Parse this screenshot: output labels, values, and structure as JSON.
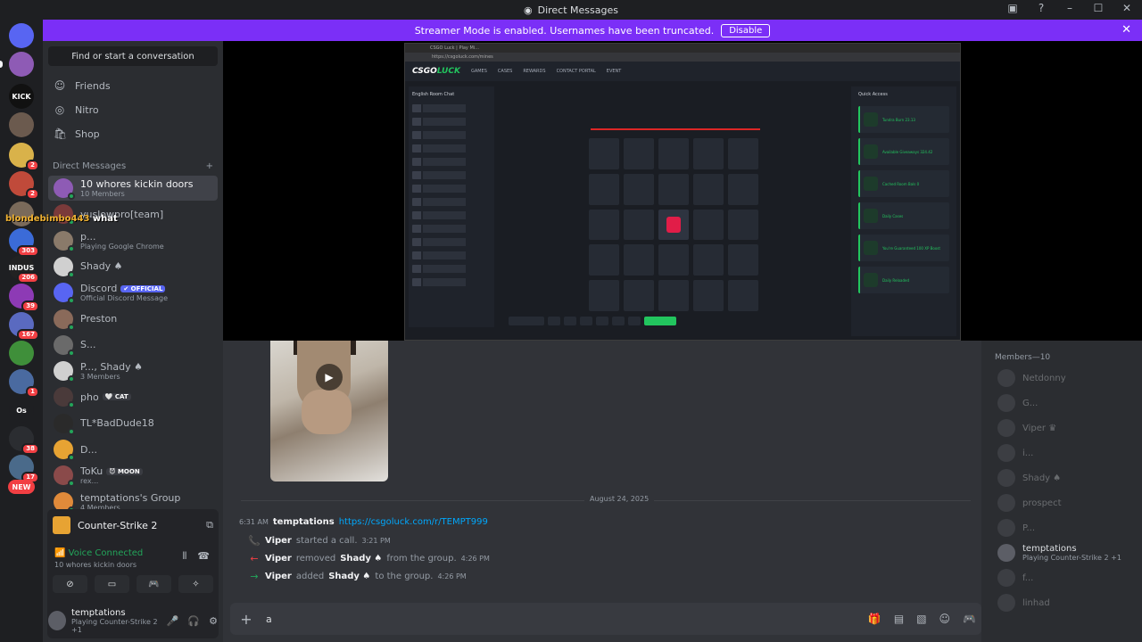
{
  "window": {
    "title": "Direct Messages"
  },
  "banner": {
    "text": "Streamer Mode is enabled. Usernames have been truncated.",
    "disable_label": "Disable"
  },
  "overlay": {
    "name": "blondebimbo443",
    "text": "what"
  },
  "guilds": [
    {
      "label": "",
      "color": "#5865f2",
      "badge": ""
    },
    {
      "label": "",
      "color": "#8e5bb5",
      "badge": ""
    },
    {
      "label": "KICK",
      "color": "#111111",
      "badge": ""
    },
    {
      "label": "",
      "color": "#6b5a4e",
      "badge": ""
    },
    {
      "label": "",
      "color": "#d9b24a",
      "badge": "2"
    },
    {
      "label": "",
      "color": "#c04a3a",
      "badge": "2"
    },
    {
      "label": "",
      "color": "#7a6a5a",
      "badge": ""
    },
    {
      "label": "",
      "color": "#3b6bd8",
      "badge": "303"
    },
    {
      "label": "INDUS",
      "color": "#222222",
      "badge": "206"
    },
    {
      "label": "",
      "color": "#8d3ab5",
      "badge": "39"
    },
    {
      "label": "",
      "color": "#5a6ac0",
      "badge": "167"
    },
    {
      "label": "",
      "color": "#3f8f3a",
      "badge": ""
    },
    {
      "label": "",
      "color": "#4a6aa0",
      "badge": "1"
    },
    {
      "label": "Os",
      "color": "#1e1f22",
      "badge": ""
    },
    {
      "label": "",
      "color": "#2b2d31",
      "badge": "38"
    },
    {
      "label": "",
      "color": "#4a6a8a",
      "badge": "17"
    },
    {
      "label": "NEW",
      "color": "#f23f43",
      "badge": ""
    }
  ],
  "sidebar": {
    "search_label": "Find or start a conversation",
    "nav": [
      {
        "label": "Friends",
        "icon": "friends-icon"
      },
      {
        "label": "Nitro",
        "icon": "nitro-icon"
      },
      {
        "label": "Shop",
        "icon": "shop-icon"
      }
    ],
    "dm_header": "Direct Messages",
    "dms": [
      {
        "name": "10 whores kickin doors",
        "sub": "10 Members",
        "color": "#8e5bb5",
        "active": true,
        "tag": "",
        "tag_color": ""
      },
      {
        "name": "yuslowpro[team]",
        "sub": "",
        "color": "#7a3a3a",
        "active": false,
        "tag": "",
        "tag_color": ""
      },
      {
        "name": "p...",
        "sub": "Playing Google Chrome",
        "color": "#8a7a6a",
        "active": false,
        "tag": "",
        "tag_color": ""
      },
      {
        "name": "Shady ♠",
        "sub": "",
        "color": "#d0d0d0",
        "active": false,
        "tag": "",
        "tag_color": ""
      },
      {
        "name": "Discord",
        "sub": "Official Discord Message",
        "color": "#5865f2",
        "active": false,
        "tag": "✔ OFFICIAL",
        "tag_color": "#5865f2"
      },
      {
        "name": "Preston",
        "sub": "",
        "color": "#8a6a5a",
        "active": false,
        "tag": "",
        "tag_color": ""
      },
      {
        "name": "S...",
        "sub": "",
        "color": "#6a6a6a",
        "active": false,
        "tag": "",
        "tag_color": ""
      },
      {
        "name": "P..., Shady ♠",
        "sub": "3 Members",
        "color": "#d0d0d0",
        "active": false,
        "tag": "",
        "tag_color": ""
      },
      {
        "name": "pho",
        "sub": "",
        "color": "#4a3a3a",
        "active": false,
        "tag": "🤍 CAT",
        "tag_color": "#3a3c42"
      },
      {
        "name": "TL*BadDude18",
        "sub": "",
        "color": "#2a2a2a",
        "active": false,
        "tag": "",
        "tag_color": ""
      },
      {
        "name": "D...",
        "sub": "",
        "color": "#e7a333",
        "active": false,
        "tag": "",
        "tag_color": ""
      },
      {
        "name": "ToKu",
        "sub": "rex...",
        "color": "#8a4a4a",
        "active": false,
        "tag": "😈 MOON",
        "tag_color": "#3a3c42"
      },
      {
        "name": "temptations's Group",
        "sub": "4 Members",
        "color": "#e08a3a",
        "active": false,
        "tag": "",
        "tag_color": ""
      }
    ]
  },
  "voice_panel": {
    "game": "Counter-Strike 2",
    "status": "Voice Connected",
    "channel": "10 whores kickin doors"
  },
  "user_panel": {
    "name": "temptations",
    "sub": "Playing Counter-Strike 2 +1"
  },
  "stream": {
    "tab_title": "CSGO Luck | Play Mi...",
    "url": "https://csgoluck.com/mines",
    "site_logo_a": "CSGO",
    "site_logo_b": "LUCK",
    "nav": [
      "GAMES",
      "CASES",
      "REWARDS",
      "CONTACT PORTAL",
      "EVENT"
    ],
    "chat_header": "English Room Chat",
    "quick_header": "Quick Access",
    "quick_items": [
      "Tundra Burn 23.13",
      "Available Giveaways 324.42",
      "Cached Room Bals 0",
      "Daily Cases",
      "You're Guaranteed 100 XP Boost",
      "Daily Reloaded"
    ]
  },
  "messages": {
    "date": "August 24, 2025",
    "main": {
      "time": "6:31 AM",
      "author": "temptations",
      "link": "https://csgoluck.com/r/TEMPT999"
    },
    "system": [
      {
        "icon": "phone-icon",
        "icon_char": "📞",
        "icon_color": "#23a55a",
        "actor": "Viper",
        "action": "started a call.",
        "target": "",
        "suffix": "",
        "time": "3:21 PM"
      },
      {
        "icon": "arrow-left-icon",
        "icon_char": "←",
        "icon_color": "#f23f43",
        "actor": "Viper",
        "action": "removed",
        "target": "Shady ♠",
        "suffix": "from the group.",
        "time": "4:26 PM"
      },
      {
        "icon": "arrow-right-icon",
        "icon_char": "→",
        "icon_color": "#23a55a",
        "actor": "Viper",
        "action": "added",
        "target": "Shady ♠",
        "suffix": "to the group.",
        "time": "4:26 PM"
      }
    ]
  },
  "composer": {
    "value": "a"
  },
  "members": {
    "header": "Members—10",
    "list": [
      {
        "name": "Netdonny",
        "sub": "",
        "online": false
      },
      {
        "name": "G...",
        "sub": "",
        "online": false
      },
      {
        "name": "Viper ♛",
        "sub": "",
        "online": false
      },
      {
        "name": "i...",
        "sub": "",
        "online": false
      },
      {
        "name": "Shady ♠",
        "sub": "",
        "online": false
      },
      {
        "name": "prospect",
        "sub": "",
        "online": false
      },
      {
        "name": "P...",
        "sub": "",
        "online": false
      },
      {
        "name": "temptations",
        "sub": "Playing Counter-Strike 2 +1",
        "online": true
      },
      {
        "name": "f...",
        "sub": "",
        "online": false
      },
      {
        "name": "linhad",
        "sub": "",
        "online": false
      }
    ]
  },
  "colors": {
    "accent": "#5865f2",
    "banner": "#7b2ff7",
    "online": "#23a55a",
    "danger": "#f23f43",
    "link": "#00a8fc"
  }
}
